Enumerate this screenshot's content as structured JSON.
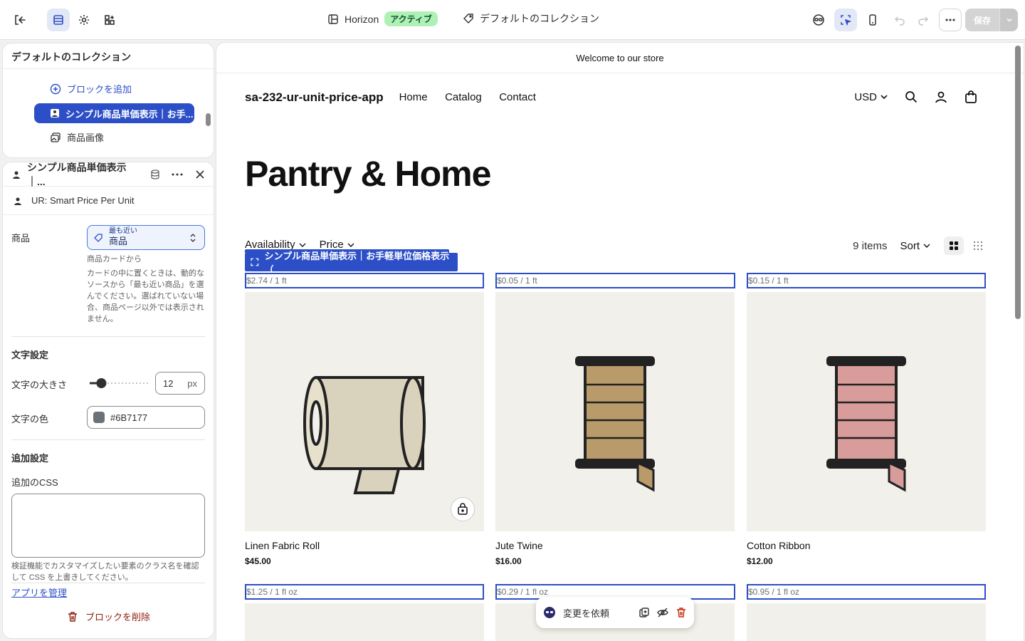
{
  "topbar": {
    "theme_name": "Horizon",
    "theme_status": "アクティブ",
    "template_name": "デフォルトのコレクション",
    "save_label": "保存"
  },
  "tree": {
    "title": "デフォルトのコレクション",
    "add_block": "ブロックを追加",
    "selected_block": "シンプル商品単価表示｜お手...",
    "product_image": "商品画像"
  },
  "settings": {
    "block_title": "シンプル商品単価表示｜...",
    "app_name": "UR: Smart Price Per Unit",
    "product_label": "商品",
    "source_small": "最も近い",
    "source_value": "商品",
    "source_hint_title": "商品カードから",
    "source_hint": "カードの中に置くときは、動的なソースから「最も近い商品」を選んでください。選ばれていない場合、商品ページ以外では表示されません。",
    "text_settings": "文字設定",
    "font_size_label": "文字の大きさ",
    "font_size_value": "12",
    "font_size_unit": "px",
    "font_size_pct": 0.2,
    "color_label": "文字の色",
    "color_value": "#6B7177",
    "extra_settings": "追加設定",
    "css_label": "追加のCSS",
    "css_hint": "検証機能でカスタマイズしたい要素のクラス名を確認して CSS を上書きしてください。",
    "manage_app": "アプリを管理",
    "delete_block": "ブロックを削除"
  },
  "store": {
    "announcement": "Welcome to our store",
    "brand": "sa-232-ur-unit-price-app",
    "nav": [
      "Home",
      "Catalog",
      "Contact"
    ],
    "currency": "USD",
    "collection_title": "Pantry & Home",
    "filter_availability": "Availability",
    "filter_price": "Price",
    "item_count": "9 items",
    "sort": "Sort",
    "block_tag": "シンプル商品単価表示｜お手軽単位価格表示（...",
    "products": [
      {
        "unit": "$2.74 / 1 ft",
        "name": "Linen Fabric Roll",
        "price": "$45.00"
      },
      {
        "unit": "$0.05 / 1 ft",
        "name": "Jute Twine",
        "price": "$16.00"
      },
      {
        "unit": "$0.15 / 1 ft",
        "name": "Cotton Ribbon",
        "price": "$12.00"
      },
      {
        "unit": "$1.25 / 1 fl oz"
      },
      {
        "unit": "$0.29 / 1 fl oz"
      },
      {
        "unit": "$0.95 / 1 fl oz"
      }
    ]
  },
  "float_bar": {
    "request_changes": "変更を依頼"
  },
  "colors": {
    "accent": "#2c4fc7",
    "unit_text": "#6B7177",
    "jute": "#b99a6b",
    "ribbon": "#d89c9a",
    "linen": "#d9d2bd"
  }
}
